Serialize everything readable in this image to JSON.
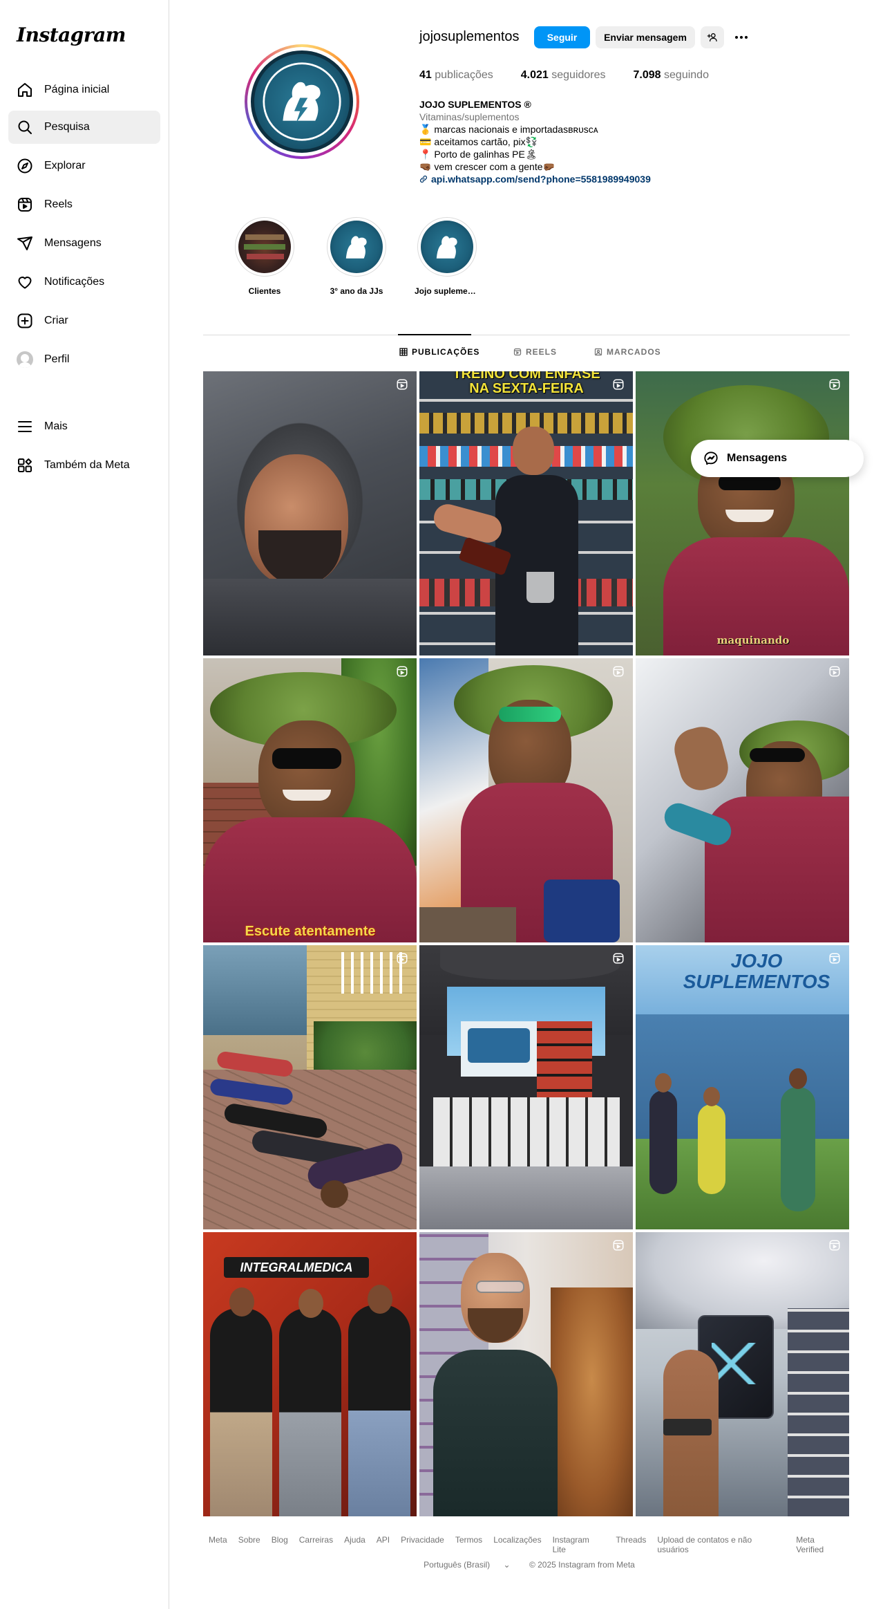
{
  "sidebar": {
    "logo": "Instagram",
    "items": [
      {
        "label": "Página inicial",
        "icon": "home-icon"
      },
      {
        "label": "Pesquisa",
        "icon": "search-icon"
      },
      {
        "label": "Explorar",
        "icon": "compass-icon"
      },
      {
        "label": "Reels",
        "icon": "reels-icon"
      },
      {
        "label": "Mensagens",
        "icon": "send-icon"
      },
      {
        "label": "Notificações",
        "icon": "heart-icon"
      },
      {
        "label": "Criar",
        "icon": "plus-square-icon"
      },
      {
        "label": "Perfil",
        "icon": "avatar"
      }
    ],
    "more": "Mais",
    "meta": "Também da Meta"
  },
  "profile": {
    "username": "jojosuplementos",
    "follow_label": "Seguir",
    "message_label": "Enviar mensagem",
    "stats": {
      "posts_count": "41",
      "posts_label": "publicações",
      "followers_count": "4.021",
      "followers_label": "seguidores",
      "following_count": "7.098",
      "following_label": "seguindo"
    },
    "bio": {
      "name": "JOJO SUPLEMENTOS ®",
      "category": "Vitaminas/suplementos",
      "line1": "🥇 marcas nacionais e importadasʙʀᴜsᴄᴀ",
      "line2": "💳 aceitamos cartão, pix💱",
      "line3": "📍 Porto de galinhas PE🏝",
      "line4": "🤜🏾 vem crescer com a gente🤛🏾",
      "link": "api.whatsapp.com/send?phone=5581989949039"
    }
  },
  "highlights": [
    {
      "label": "Clientes"
    },
    {
      "label": "3° ano da JJs"
    },
    {
      "label": "Jojo suplementos"
    }
  ],
  "tabs": [
    {
      "label": "PUBLICAÇÕES"
    },
    {
      "label": "REELS"
    },
    {
      "label": "MARCADOS"
    }
  ],
  "posts": {
    "captions": {
      "p2": "TREINO COM ÊNFASE NA SEXTA-FEIRA",
      "p3": "maquinando",
      "p4": "Escute atentamente",
      "p9_sign": "JOJO SUPLEMENTOS",
      "p10_sign": "INTEGRALMEDICA"
    }
  },
  "messages_pill": "Mensagens",
  "footer": {
    "links": [
      "Meta",
      "Sobre",
      "Blog",
      "Carreiras",
      "Ajuda",
      "API",
      "Privacidade",
      "Termos",
      "Localizações",
      "Instagram Lite",
      "Threads",
      "Upload de contatos e não usuários",
      "Meta Verified"
    ],
    "language": "Português (Brasil)",
    "copyright": "© 2025 Instagram from Meta"
  },
  "colors": {
    "accent": "#0095f6",
    "link": "#00376b",
    "muted": "#737373"
  }
}
